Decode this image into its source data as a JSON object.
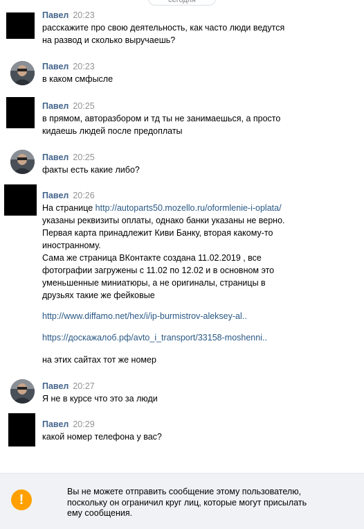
{
  "date_separator": "сегодня",
  "messages": [
    {
      "author": "Павел",
      "time": "20:23",
      "avatar": "black-square",
      "lines": [
        "расскажите про свою деятельность, как часто люди ведутся",
        "на развод и сколько выручаешь?"
      ]
    },
    {
      "author": "Павел",
      "time": "20:23",
      "avatar": "profile-photo",
      "lines": [
        "в каком смфысле"
      ]
    },
    {
      "author": "Павел",
      "time": "20:25",
      "avatar": "black-square",
      "lines": [
        "в прямом, авторазбором и тд ты не занимаешься, а просто",
        "кидаешь людей после предоплаты"
      ]
    },
    {
      "author": "Павел",
      "time": "20:25",
      "avatar": "profile-photo",
      "lines": [
        "факты есть какие либо?"
      ]
    },
    {
      "author": "Павел",
      "time": "20:26",
      "avatar": "black-square",
      "line1_prefix": "На странице ",
      "line1_link": "http://autoparts50.mozello.ru/oformlenie-i-oplata/",
      "lines": [
        "указаны реквизиты оплаты, однако банки указаны не верно.",
        "Первая карта принадлежит Киви Банку, вторая какому-то",
        "иностранному.",
        "Сама же страница ВКонтакте создана 11.02.2019 , все",
        "фотографии загружены с 11.02 по 12.02 и в основном это",
        "уменьшенные миниатюры, а не оригиналы, страницы в",
        "друзьях такие же фейковые"
      ],
      "link2": "http://www.diffamo.net/hex/i/ip-burmistrov-aleksey-al..",
      "link3": "https://доскажалоб.рф/avto_i_transport/33158-moshenni..",
      "last_line": "на этих сайтах тот же номер"
    },
    {
      "author": "Павел",
      "time": "20:27",
      "avatar": "profile-photo",
      "lines": [
        "Я не в курсе что это за люди"
      ]
    },
    {
      "author": "Павел",
      "time": "20:29",
      "avatar": "black-square",
      "lines": [
        "какой номер телефона у вас?"
      ]
    }
  ],
  "notice": {
    "icon": "exclamation-icon",
    "icon_glyph": "!",
    "lines": [
      "Вы не можете отправить сообщение этому пользователю,",
      "поскольку он ограничил круг лиц, которые могут присылать",
      "ему сообщения."
    ]
  },
  "colors": {
    "author": "#42648b",
    "time": "#939393",
    "link": "#2a5885",
    "notice_bg": "#f0f2f5",
    "warning": "#ffa000"
  }
}
